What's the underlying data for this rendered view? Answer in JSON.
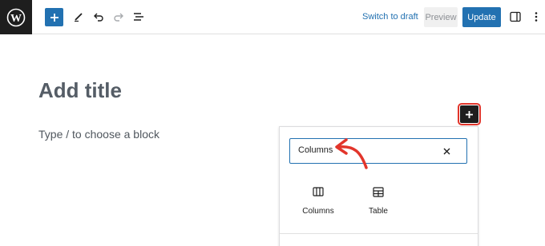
{
  "toolbar": {
    "logo_icon": "wordpress-logo",
    "inserter_icon": "plus-icon",
    "tools": [
      "pen-icon",
      "undo-icon",
      "redo-icon",
      "list-view-icon"
    ],
    "switch_to_draft": "Switch to draft",
    "preview": "Preview",
    "update": "Update",
    "settings_icon": "sidebar-toggle-icon",
    "more_icon": "more-vertical-icon"
  },
  "editor": {
    "title_placeholder": "Add title",
    "block_placeholder": "Type / to choose a block",
    "inline_inserter_icon": "plus-icon"
  },
  "inserter": {
    "search_value": "Columns",
    "clear_icon": "close-icon",
    "results": [
      {
        "label": "Columns",
        "icon": "columns-icon"
      },
      {
        "label": "Table",
        "icon": "table-icon"
      }
    ]
  },
  "colors": {
    "accent": "#2271b1",
    "annotation": "#e2352b",
    "dark": "#1e1e1e"
  }
}
